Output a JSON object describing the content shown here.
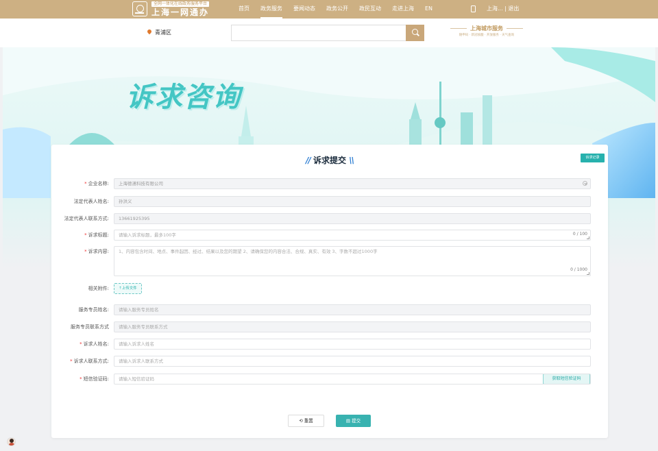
{
  "header": {
    "logo_tagline": "全网一体化在线政务服务平台",
    "logo_title": "上海一网通办",
    "nav": [
      {
        "label": "首页",
        "active": false
      },
      {
        "label": "政务服务",
        "active": true
      },
      {
        "label": "要闻动态",
        "active": false
      },
      {
        "label": "政务公开",
        "active": false
      },
      {
        "label": "政民互动",
        "active": false
      },
      {
        "label": "走进上海",
        "active": false
      },
      {
        "label": "EN",
        "active": false
      }
    ],
    "user_links": "上海... | 退出",
    "icons": {
      "logo": "emblem-logo",
      "phone": "mobile-phone-icon"
    }
  },
  "subheader": {
    "location": "青浦区",
    "search_placeholder": "",
    "city_brand_title": "上海城市服务",
    "city_brand_subtitle": "随申码 · 新冠核酸 · 开放服务 · 天气查询"
  },
  "banner": {
    "title": "诉求咨询"
  },
  "form": {
    "title": "诉求提交",
    "record_button": "诉求记录",
    "fields": [
      {
        "label": "企业名称:",
        "required": true,
        "value": "上海德潇科技有限公司",
        "placeholder": "",
        "disabled": true
      },
      {
        "label": "法定代表人姓名:",
        "required": false,
        "value": "孙洪义",
        "placeholder": "",
        "disabled": true
      },
      {
        "label": "法定代表人联系方式:",
        "required": false,
        "value": "13661925395",
        "placeholder": "",
        "disabled": true
      },
      {
        "label": "诉求标题:",
        "required": true,
        "value": "",
        "placeholder": "请输入诉求标题，最多100字",
        "counter": "0 / 100"
      },
      {
        "label": "诉求内容:",
        "required": true,
        "value": "",
        "placeholder": "1、内容包含时间、地点、事件起因、经过、结果以及您的期望 2、请确保您的内容合法、合规、真实、有效 3、字数不超过1000字",
        "counter": "0 / 1000"
      },
      {
        "label": "相关附件:",
        "required": false,
        "button": "上传文件"
      },
      {
        "label": "服务专员姓名:",
        "required": false,
        "value": "",
        "placeholder": "请输入服务专员姓名",
        "disabled": true
      },
      {
        "label": "服务专员联系方式",
        "required": false,
        "value": "",
        "placeholder": "请输入服务专员联系方式",
        "disabled": true
      },
      {
        "label": "诉求人姓名:",
        "required": true,
        "value": "",
        "placeholder": "请输入诉求人姓名"
      },
      {
        "label": "诉求人联系方式:",
        "required": true,
        "value": "",
        "placeholder": "请输入诉求人联系方式"
      },
      {
        "label": "短信验证码:",
        "required": true,
        "value": "",
        "placeholder": "请输入短信验证码",
        "button": "获取短信验证码"
      }
    ],
    "reset_button": "重置",
    "submit_button": "提交"
  },
  "colors": {
    "brand_gold": "#cdb083",
    "accent_teal": "#38b2b0",
    "required_red": "#e33333"
  }
}
